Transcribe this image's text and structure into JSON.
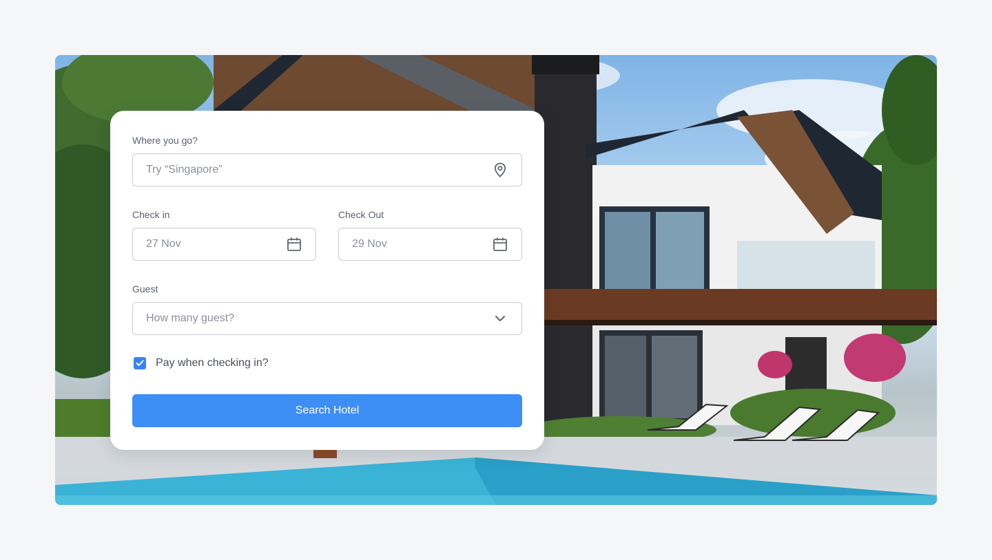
{
  "hero": {
    "image": "modern-house-with-pool"
  },
  "form": {
    "destination": {
      "label": "Where you go?",
      "placeholder": "Try “Singapore”",
      "icon": "location-pin-icon"
    },
    "check_in": {
      "label": "Check in",
      "value": "27 Nov",
      "icon": "calendar-icon"
    },
    "check_out": {
      "label": "Check Out",
      "value": "29 Nov",
      "icon": "calendar-icon"
    },
    "guest": {
      "label": "Guest",
      "placeholder": "How many guest?",
      "icon": "chevron-down-icon"
    },
    "pay_checkbox": {
      "label": "Pay when checking in?",
      "checked": true
    },
    "submit_label": "Search Hotel"
  },
  "colors": {
    "accent": "#3d8ef5",
    "page_bg": "#f5f6f8",
    "card_bg": "#ffffff"
  }
}
